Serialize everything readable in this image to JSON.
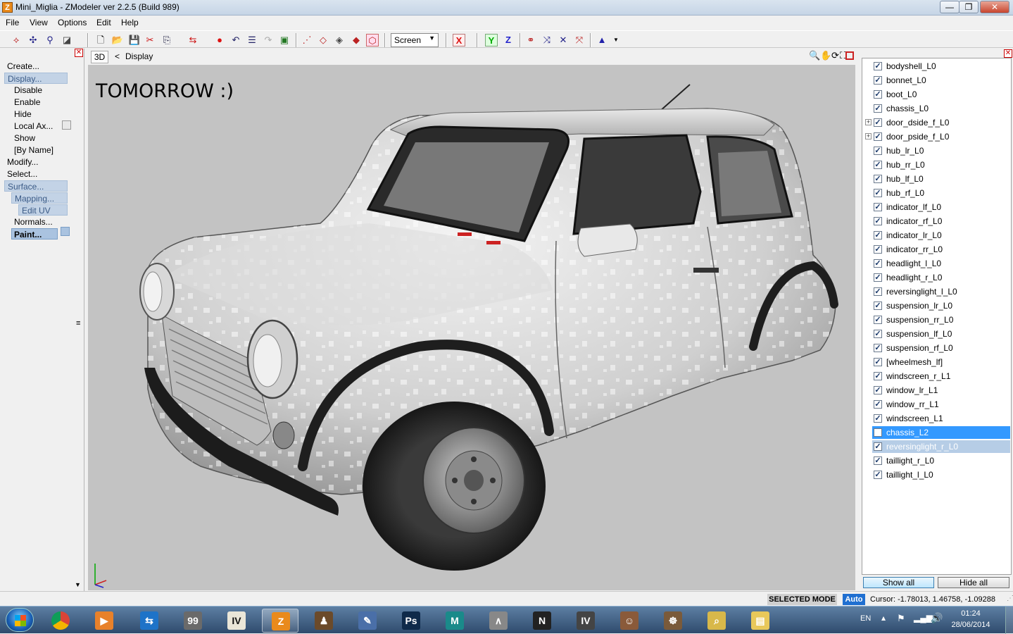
{
  "window": {
    "title": "Mini_Miglia - ZModeler ver 2.2.5 (Build 989)",
    "app_icon": "Z",
    "minimize": "—",
    "maximize": "❐",
    "close": "✕"
  },
  "menu": [
    "File",
    "View",
    "Options",
    "Edit",
    "Help"
  ],
  "toolbar": {
    "coord_space": "Screen",
    "axis_x": "X",
    "axis_y": "Y",
    "axis_z": "Z"
  },
  "left_panel": {
    "items": [
      {
        "label": "Create...",
        "level": 0,
        "state": "normal"
      },
      {
        "label": "Display...",
        "level": 0,
        "state": "selected"
      },
      {
        "label": "Disable",
        "level": 1,
        "state": "normal"
      },
      {
        "label": "Enable",
        "level": 1,
        "state": "normal"
      },
      {
        "label": "Hide",
        "level": 1,
        "state": "normal"
      },
      {
        "label": "Local Ax...",
        "level": 1,
        "state": "normal"
      },
      {
        "label": "Show",
        "level": 1,
        "state": "normal"
      },
      {
        "label": "[By Name]",
        "level": 1,
        "state": "normal"
      },
      {
        "label": "Modify...",
        "level": 0,
        "state": "normal"
      },
      {
        "label": "Select...",
        "level": 0,
        "state": "normal"
      },
      {
        "label": "Surface...",
        "level": 0,
        "state": "selected"
      },
      {
        "label": "Mapping...",
        "level": 1,
        "state": "selected"
      },
      {
        "label": "Edit UV",
        "level": 2,
        "state": "selected"
      },
      {
        "label": "Normals...",
        "level": 1,
        "state": "normal"
      },
      {
        "label": "Paint...",
        "level": 1,
        "state": "active"
      }
    ]
  },
  "viewport": {
    "mode": "3D",
    "back": "<",
    "breadcrumb": "Display",
    "overlay_text": "TOMORROW :)",
    "colors": {
      "background": "#c3c3c3"
    }
  },
  "objects": [
    {
      "name": "bodyshell_L0",
      "checked": true,
      "expandable": false,
      "state": "normal"
    },
    {
      "name": "bonnet_L0",
      "checked": true,
      "expandable": false,
      "state": "normal"
    },
    {
      "name": "boot_L0",
      "checked": true,
      "expandable": false,
      "state": "normal"
    },
    {
      "name": "chassis_L0",
      "checked": true,
      "expandable": false,
      "state": "normal"
    },
    {
      "name": "door_dside_f_L0",
      "checked": true,
      "expandable": true,
      "state": "normal"
    },
    {
      "name": "door_pside_f_L0",
      "checked": true,
      "expandable": true,
      "state": "normal"
    },
    {
      "name": "hub_lr_L0",
      "checked": true,
      "expandable": false,
      "state": "normal"
    },
    {
      "name": "hub_rr_L0",
      "checked": true,
      "expandable": false,
      "state": "normal"
    },
    {
      "name": "hub_lf_L0",
      "checked": true,
      "expandable": false,
      "state": "normal"
    },
    {
      "name": "hub_rf_L0",
      "checked": true,
      "expandable": false,
      "state": "normal"
    },
    {
      "name": "indicator_lf_L0",
      "checked": true,
      "expandable": false,
      "state": "normal"
    },
    {
      "name": "indicator_rf_L0",
      "checked": true,
      "expandable": false,
      "state": "normal"
    },
    {
      "name": "indicator_lr_L0",
      "checked": true,
      "expandable": false,
      "state": "normal"
    },
    {
      "name": "indicator_rr_L0",
      "checked": true,
      "expandable": false,
      "state": "normal"
    },
    {
      "name": "headlight_l_L0",
      "checked": true,
      "expandable": false,
      "state": "normal"
    },
    {
      "name": "headlight_r_L0",
      "checked": true,
      "expandable": false,
      "state": "normal"
    },
    {
      "name": "reversinglight_l_L0",
      "checked": true,
      "expandable": false,
      "state": "normal"
    },
    {
      "name": "suspension_lr_L0",
      "checked": true,
      "expandable": false,
      "state": "normal"
    },
    {
      "name": "suspension_rr_L0",
      "checked": true,
      "expandable": false,
      "state": "normal"
    },
    {
      "name": "suspension_lf_L0",
      "checked": true,
      "expandable": false,
      "state": "normal"
    },
    {
      "name": "suspension_rf_L0",
      "checked": true,
      "expandable": false,
      "state": "normal"
    },
    {
      "name": "[wheelmesh_lf]",
      "checked": true,
      "expandable": false,
      "state": "normal"
    },
    {
      "name": "windscreen_r_L1",
      "checked": true,
      "expandable": false,
      "state": "normal"
    },
    {
      "name": "window_lr_L1",
      "checked": true,
      "expandable": false,
      "state": "normal"
    },
    {
      "name": "window_rr_L1",
      "checked": true,
      "expandable": false,
      "state": "normal"
    },
    {
      "name": "windscreen_L1",
      "checked": true,
      "expandable": false,
      "state": "normal"
    },
    {
      "name": "chassis_L2",
      "checked": false,
      "expandable": false,
      "state": "highlight"
    },
    {
      "name": "reversinglight_r_L0",
      "checked": true,
      "expandable": false,
      "state": "selected"
    },
    {
      "name": "taillight_r_L0",
      "checked": true,
      "expandable": false,
      "state": "normal"
    },
    {
      "name": "taillight_l_L0",
      "checked": true,
      "expandable": false,
      "state": "normal"
    }
  ],
  "right_buttons": {
    "show_all": "Show all",
    "hide_all": "Hide all"
  },
  "status": {
    "mode": "SELECTED MODE",
    "snap": "Auto",
    "cursor": "Cursor: -1.78013, 1.46758, -1.09288"
  },
  "taskbar": {
    "apps": [
      {
        "icon": "chrome-icon",
        "glyph": "",
        "color": "#d33"
      },
      {
        "icon": "media-player-icon",
        "glyph": "▶",
        "color": "#e8812a"
      },
      {
        "icon": "teamviewer-icon",
        "glyph": "⇆",
        "color": "#1e73c8"
      },
      {
        "icon": "monitor-app-icon",
        "glyph": "99",
        "color": "#6a6a6a"
      },
      {
        "icon": "openiv-icon",
        "glyph": "IV",
        "color": "#eae6d8"
      },
      {
        "icon": "zmodeler-icon",
        "glyph": "Z",
        "color": "#e98a1c"
      },
      {
        "icon": "gta-icon",
        "glyph": "♟",
        "color": "#6b4a2a"
      },
      {
        "icon": "paint-app-icon",
        "glyph": "✎",
        "color": "#4a6fa8"
      },
      {
        "icon": "photoshop-icon",
        "glyph": "Ps",
        "color": "#0f2a4a"
      },
      {
        "icon": "max-icon",
        "glyph": "M",
        "color": "#1a8a8a"
      },
      {
        "icon": "network-icon",
        "glyph": "∧",
        "color": "#888"
      },
      {
        "icon": "nfs-icon",
        "glyph": "N",
        "color": "#222"
      },
      {
        "icon": "gta-iv-icon",
        "glyph": "IV",
        "color": "#444"
      },
      {
        "icon": "game-icon",
        "glyph": "☺",
        "color": "#8a5a3a"
      },
      {
        "icon": "wheel-icon",
        "glyph": "☸",
        "color": "#7a5a3a"
      },
      {
        "icon": "search-icon",
        "glyph": "⌕",
        "color": "#d8b84a"
      },
      {
        "icon": "folder-icon",
        "glyph": "▤",
        "color": "#e8c85a"
      }
    ],
    "lang": "EN",
    "time": "01:24",
    "date": "28/06/2014"
  }
}
